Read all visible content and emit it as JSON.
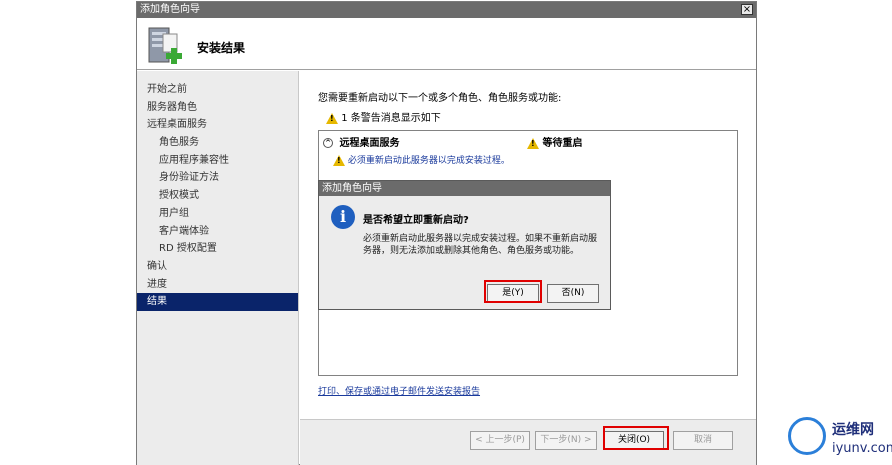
{
  "window": {
    "title": "添加角色向导",
    "close_glyph": "×",
    "header_title": "安装结果"
  },
  "nav": {
    "items": [
      {
        "label": "开始之前",
        "sub": false,
        "active": false
      },
      {
        "label": "服务器角色",
        "sub": false,
        "active": false
      },
      {
        "label": "远程桌面服务",
        "sub": false,
        "active": false
      },
      {
        "label": "角色服务",
        "sub": true,
        "active": false
      },
      {
        "label": "应用程序兼容性",
        "sub": true,
        "active": false
      },
      {
        "label": "身份验证方法",
        "sub": true,
        "active": false
      },
      {
        "label": "授权模式",
        "sub": true,
        "active": false
      },
      {
        "label": "用户组",
        "sub": true,
        "active": false
      },
      {
        "label": "客户端体验",
        "sub": true,
        "active": false
      },
      {
        "label": "RD 授权配置",
        "sub": true,
        "active": false
      },
      {
        "label": "确认",
        "sub": false,
        "active": false
      },
      {
        "label": "进度",
        "sub": false,
        "active": false
      },
      {
        "label": "结果",
        "sub": false,
        "active": true
      }
    ]
  },
  "content": {
    "intro": "您需要重新启动以下一个或多个角色、角色服务或功能:",
    "count_prefix": "1",
    "count_text": "条警告消息显示如下",
    "results": {
      "collapse_glyph": "^",
      "role": "远程桌面服务",
      "status": "等待重启",
      "message": "必须重新启动此服务器以完成安装过程。"
    },
    "link": "打印、保存或通过电子邮件发送安装报告"
  },
  "footer": {
    "prev_label": "< 上一步(P)",
    "next_label": "下一步(N) >",
    "close_label": "关闭(O)",
    "cancel_label": "取消"
  },
  "dialog": {
    "title": "添加角色向导",
    "info_glyph": "i",
    "question": "是否希望立即重新启动?",
    "detail": "必须重新启动此服务器以完成安装过程。如果不重新启动服务器，则无法添加或删除其他角色、角色服务或功能。",
    "yes_label": "是(Y)",
    "no_label": "否(N)"
  },
  "watermark": {
    "line1": "运维网",
    "line2": "iyunv.com"
  },
  "colors": {
    "highlight": "#e00000",
    "active_nav": "#0a246a",
    "link": "#1a3a9c",
    "warning": "#e6b800"
  }
}
